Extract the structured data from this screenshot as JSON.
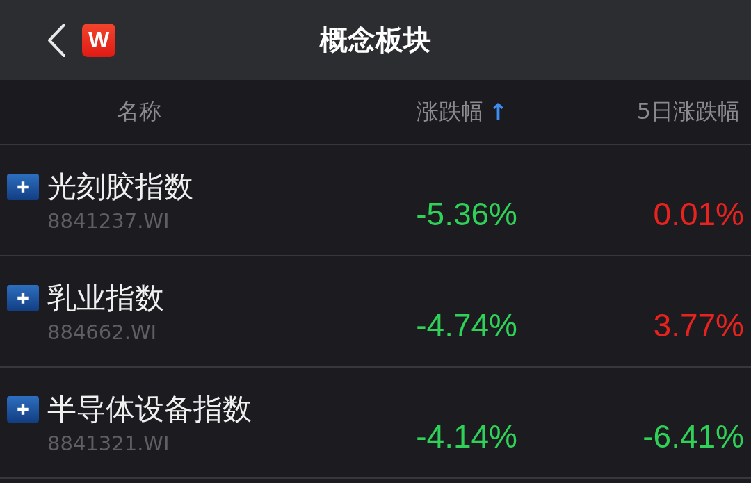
{
  "header": {
    "title": "概念板块",
    "logo": "W"
  },
  "columns": [
    {
      "label": "名称"
    },
    {
      "label": "涨跌幅",
      "sort": "↑"
    },
    {
      "label": "5日涨跌幅"
    }
  ],
  "rows": [
    {
      "name": "光刻胶指数",
      "code": "8841237.WI",
      "change": {
        "text": "-5.36%",
        "color": "#2fd158"
      },
      "change_5d": {
        "text": "0.01%",
        "color": "#e8231f"
      }
    },
    {
      "name": "乳业指数",
      "code": "884662.WI",
      "change": {
        "text": "-4.74%",
        "color": "#2fd158"
      },
      "change_5d": {
        "text": "3.77%",
        "color": "#e8231f"
      }
    },
    {
      "name": "半导体设备指数",
      "code": "8841321.WI",
      "change": {
        "text": "-4.14%",
        "color": "#2fd158"
      },
      "change_5d": {
        "text": "-6.41%",
        "color": "#2fd158"
      }
    }
  ]
}
